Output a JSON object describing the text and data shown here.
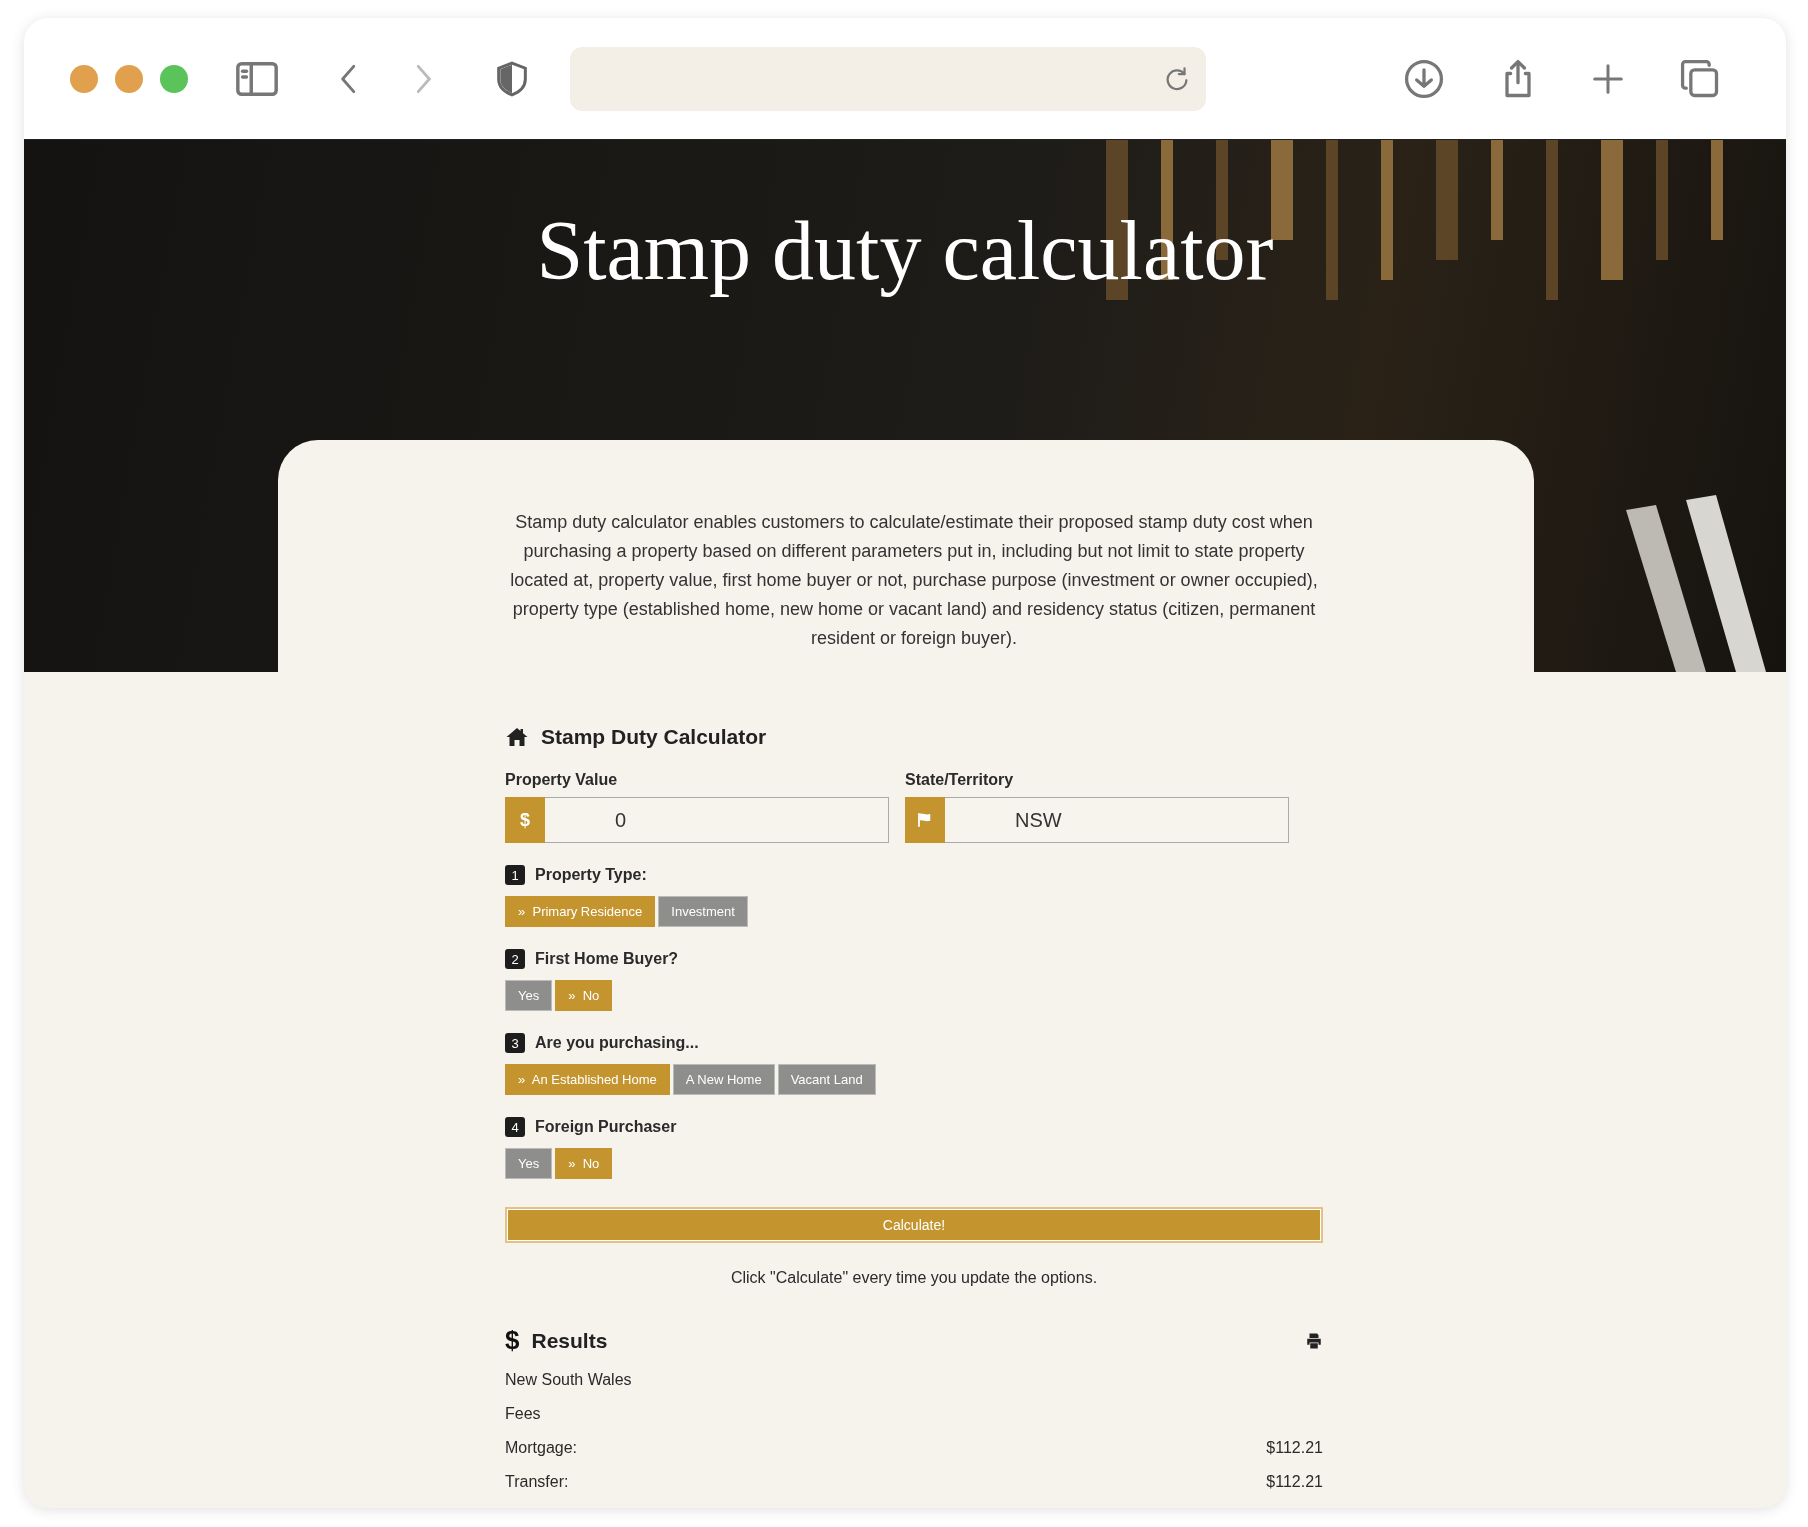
{
  "hero": {
    "title": "Stamp duty calculator"
  },
  "description": "Stamp duty calculator enables customers to calculate/estimate their proposed stamp duty cost when purchasing a property based on different parameters put in, including but not limit to state property located at, property value, first home buyer or not, purchase purpose (investment or owner occupied), property type (established home, new home or vacant land) and residency status (citizen, permanent resident or foreign buyer).",
  "calculator": {
    "title": "Stamp Duty Calculator",
    "fields": [
      {
        "kind": "currency",
        "label": "Property Value",
        "addon": "$",
        "value": "0"
      },
      {
        "kind": "region",
        "label": "State/Territory",
        "value": "NSW"
      }
    ],
    "selected_marker": "»",
    "steps": [
      {
        "number": "1",
        "label": "Property Type:",
        "options": [
          {
            "label": "Primary Residence",
            "selected": true
          },
          {
            "label": "Investment",
            "selected": false
          }
        ]
      },
      {
        "number": "2",
        "label": "First Home Buyer?",
        "options": [
          {
            "label": "Yes",
            "selected": false
          },
          {
            "label": "No",
            "selected": true
          }
        ]
      },
      {
        "number": "3",
        "label": "Are you purchasing...",
        "options": [
          {
            "label": "An Established Home",
            "selected": true
          },
          {
            "label": "A New Home",
            "selected": false
          },
          {
            "label": "Vacant Land",
            "selected": false
          }
        ]
      },
      {
        "number": "4",
        "label": "Foreign Purchaser",
        "options": [
          {
            "label": "Yes",
            "selected": false
          },
          {
            "label": "No",
            "selected": true
          }
        ]
      }
    ],
    "calculate_button": "Calculate!",
    "note": "Click \"Calculate\" every time you update the options."
  },
  "results": {
    "icon": "$",
    "title": "Results",
    "rows": [
      {
        "label": "New South Wales"
      },
      {
        "label": "Fees"
      },
      {
        "label": "Mortgage:",
        "value": "$112.21"
      },
      {
        "label": "Transfer:",
        "value": "$112.21"
      }
    ]
  }
}
